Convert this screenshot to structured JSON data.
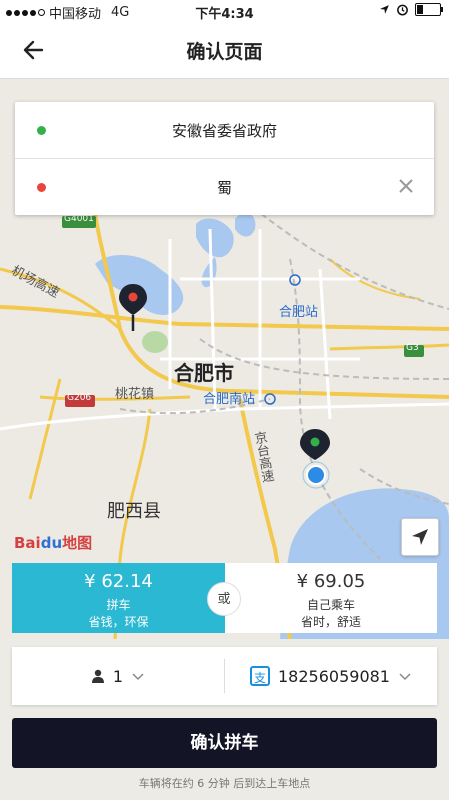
{
  "status_bar": {
    "carrier": "中国移动",
    "network": "4G",
    "time": "下午4:34"
  },
  "nav": {
    "title": "确认页面",
    "back_icon": "arrow-left-icon"
  },
  "route": {
    "from": "安徽省委省政府",
    "to": "蜀",
    "from_color": "#34b04a",
    "to_color": "#e8463a",
    "clear_icon": "close-icon"
  },
  "map": {
    "city": "合肥市",
    "county": "肥西县",
    "labels": {
      "airport_highway": "机场高速",
      "taohua": "桃花镇",
      "hefei_station": "合肥站",
      "hefei_south": "合肥南站",
      "jingtai": "京台高速",
      "g206": "G206",
      "g3": "G3",
      "g4001": "G4001"
    },
    "logo": "Baidu地图",
    "locate_icon": "navigation-arrow-icon"
  },
  "fares": {
    "pool": {
      "price": "¥ 62.14",
      "name": "拼车",
      "desc": "省钱，环保"
    },
    "separator": "或",
    "self": {
      "price": "¥ 69.05",
      "name": "自己乘车",
      "desc": "省时，舒适"
    }
  },
  "options": {
    "seats": "1",
    "seat_icon": "person-icon",
    "payment_icon": "alipay-icon",
    "payment_icon_text": "支",
    "phone": "18256059081"
  },
  "confirm_label": "确认拼车",
  "footnote": "车辆将在约 6 分钟 后到达上车地点",
  "colors": {
    "accent": "#2bb8d3",
    "dark": "#131426"
  }
}
